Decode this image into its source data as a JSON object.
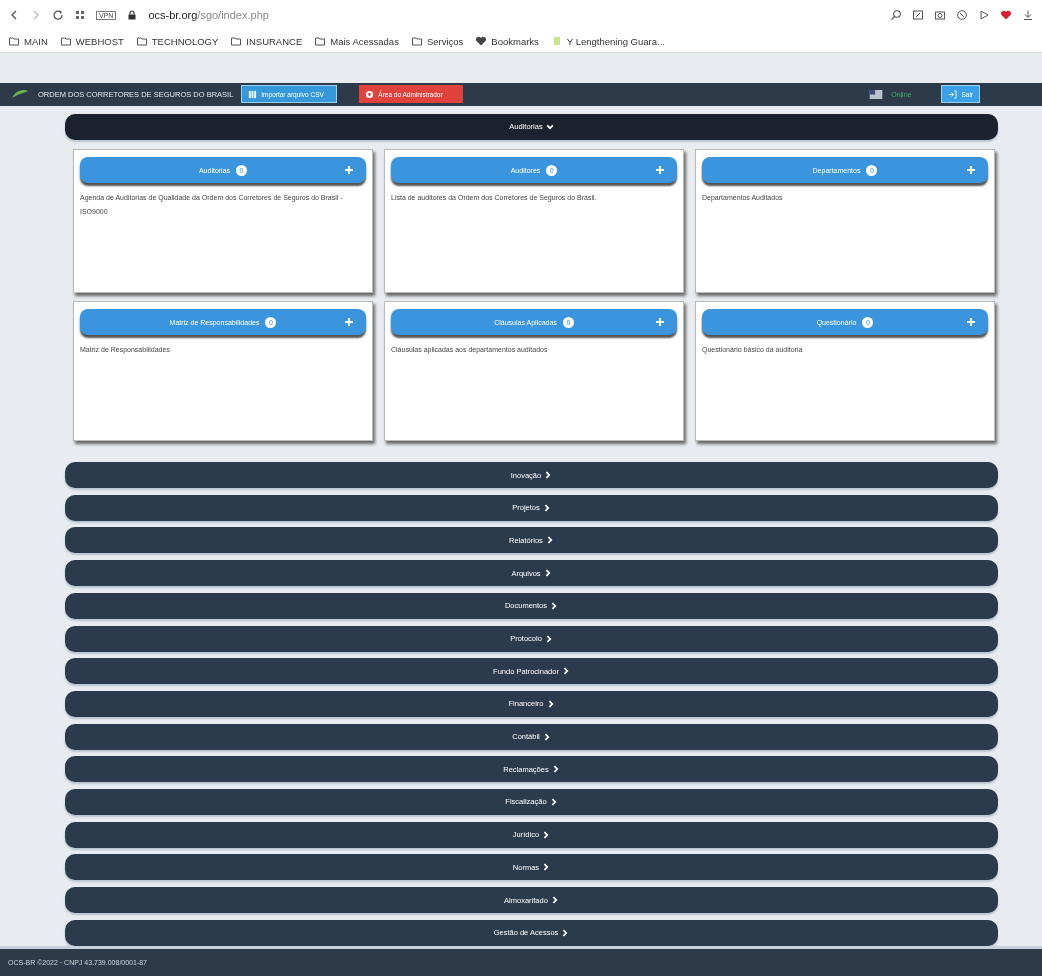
{
  "browser": {
    "url_host": "ocs-br.org",
    "url_path": "/sgo/index.php",
    "vpn": "VPN",
    "bookmarks": [
      {
        "label": "MAIN",
        "kind": "folder"
      },
      {
        "label": "WEBHOST",
        "kind": "folder"
      },
      {
        "label": "TECHNOLOGY",
        "kind": "folder"
      },
      {
        "label": "INSURANCE",
        "kind": "folder"
      },
      {
        "label": "Mais Acessadas",
        "kind": "folder"
      },
      {
        "label": "Serviços",
        "kind": "folder"
      },
      {
        "label": "Bookmarks",
        "kind": "heart"
      },
      {
        "label": "Y Lengthening Guara...",
        "kind": "page"
      }
    ]
  },
  "header": {
    "title": "ORDEM DOS CORRETORES DE SEGUROS DO BRASIL",
    "import_button": "Importar arquivo CSV",
    "admin_button": "Área do Administrador",
    "status": "Online",
    "logout_button": "Sair"
  },
  "sections": [
    {
      "label": "Auditorias",
      "expanded": true,
      "cards": [
        {
          "title": "Auditorias",
          "count": "0",
          "description": "Agenda de Auditorias de Qualidade da Ordem dos Corretores de Seguros do Brasil - ISO9000"
        },
        {
          "title": "Auditores",
          "count": "0",
          "description": "Lista de auditores da Ordem dos Corretores de Seguros do Brasil."
        },
        {
          "title": "Departamentos",
          "count": "0",
          "description": "Departamentos Auditados"
        },
        {
          "title": "Matriz de Responsabilidades",
          "count": "0",
          "description": "Matriz de Responsabilidades"
        },
        {
          "title": "Cláusulas Aplicadas",
          "count": "0",
          "description": "Cláusulas aplicadas aos departamentos auditados"
        },
        {
          "title": "Questionário",
          "count": "0",
          "description": "Questionário básico da auditoria"
        }
      ]
    },
    {
      "label": "Inovação",
      "expanded": false
    },
    {
      "label": "Projetos",
      "expanded": false
    },
    {
      "label": "Relatórios",
      "expanded": false
    },
    {
      "label": "Arquivos",
      "expanded": false
    },
    {
      "label": "Documentos",
      "expanded": false
    },
    {
      "label": "Protocolo",
      "expanded": false
    },
    {
      "label": "Fundo Patrocinador",
      "expanded": false
    },
    {
      "label": "Financeiro",
      "expanded": false
    },
    {
      "label": "Contábil",
      "expanded": false
    },
    {
      "label": "Reclamações",
      "expanded": false
    },
    {
      "label": "Fiscalização",
      "expanded": false
    },
    {
      "label": "Jurídico",
      "expanded": false
    },
    {
      "label": "Normas",
      "expanded": false
    },
    {
      "label": "Almoxarifado",
      "expanded": false
    },
    {
      "label": "Gestão de Acessos",
      "expanded": false
    }
  ],
  "footer": "OCS-BR ©2022 · CNPJ 43.739.008/0001-87"
}
